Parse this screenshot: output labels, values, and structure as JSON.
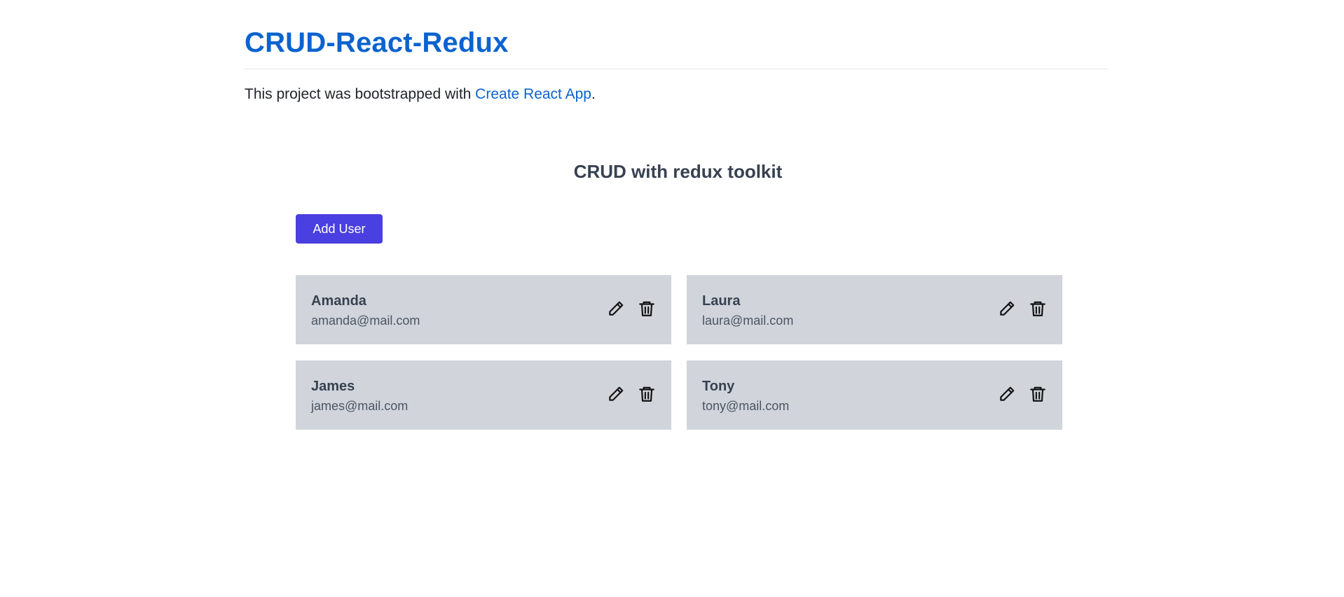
{
  "readme": {
    "title": "CRUD-React-Redux",
    "text_before_link": "This project was bootstrapped with ",
    "link_text": "Create React App",
    "text_after_link": "."
  },
  "app": {
    "title": "CRUD with redux toolkit",
    "add_button_label": "Add User",
    "accent_color": "#4a3fe0",
    "card_color": "#d1d5db"
  },
  "users": [
    {
      "name": "Amanda",
      "email": "amanda@mail.com",
      "edit_icon": "pencil-icon",
      "delete_icon": "trash-icon"
    },
    {
      "name": "Laura",
      "email": "laura@mail.com",
      "edit_icon": "pencil-icon",
      "delete_icon": "trash-icon"
    },
    {
      "name": "James",
      "email": "james@mail.com",
      "edit_icon": "pencil-icon",
      "delete_icon": "trash-icon"
    },
    {
      "name": "Tony",
      "email": "tony@mail.com",
      "edit_icon": "pencil-icon",
      "delete_icon": "trash-icon"
    }
  ]
}
